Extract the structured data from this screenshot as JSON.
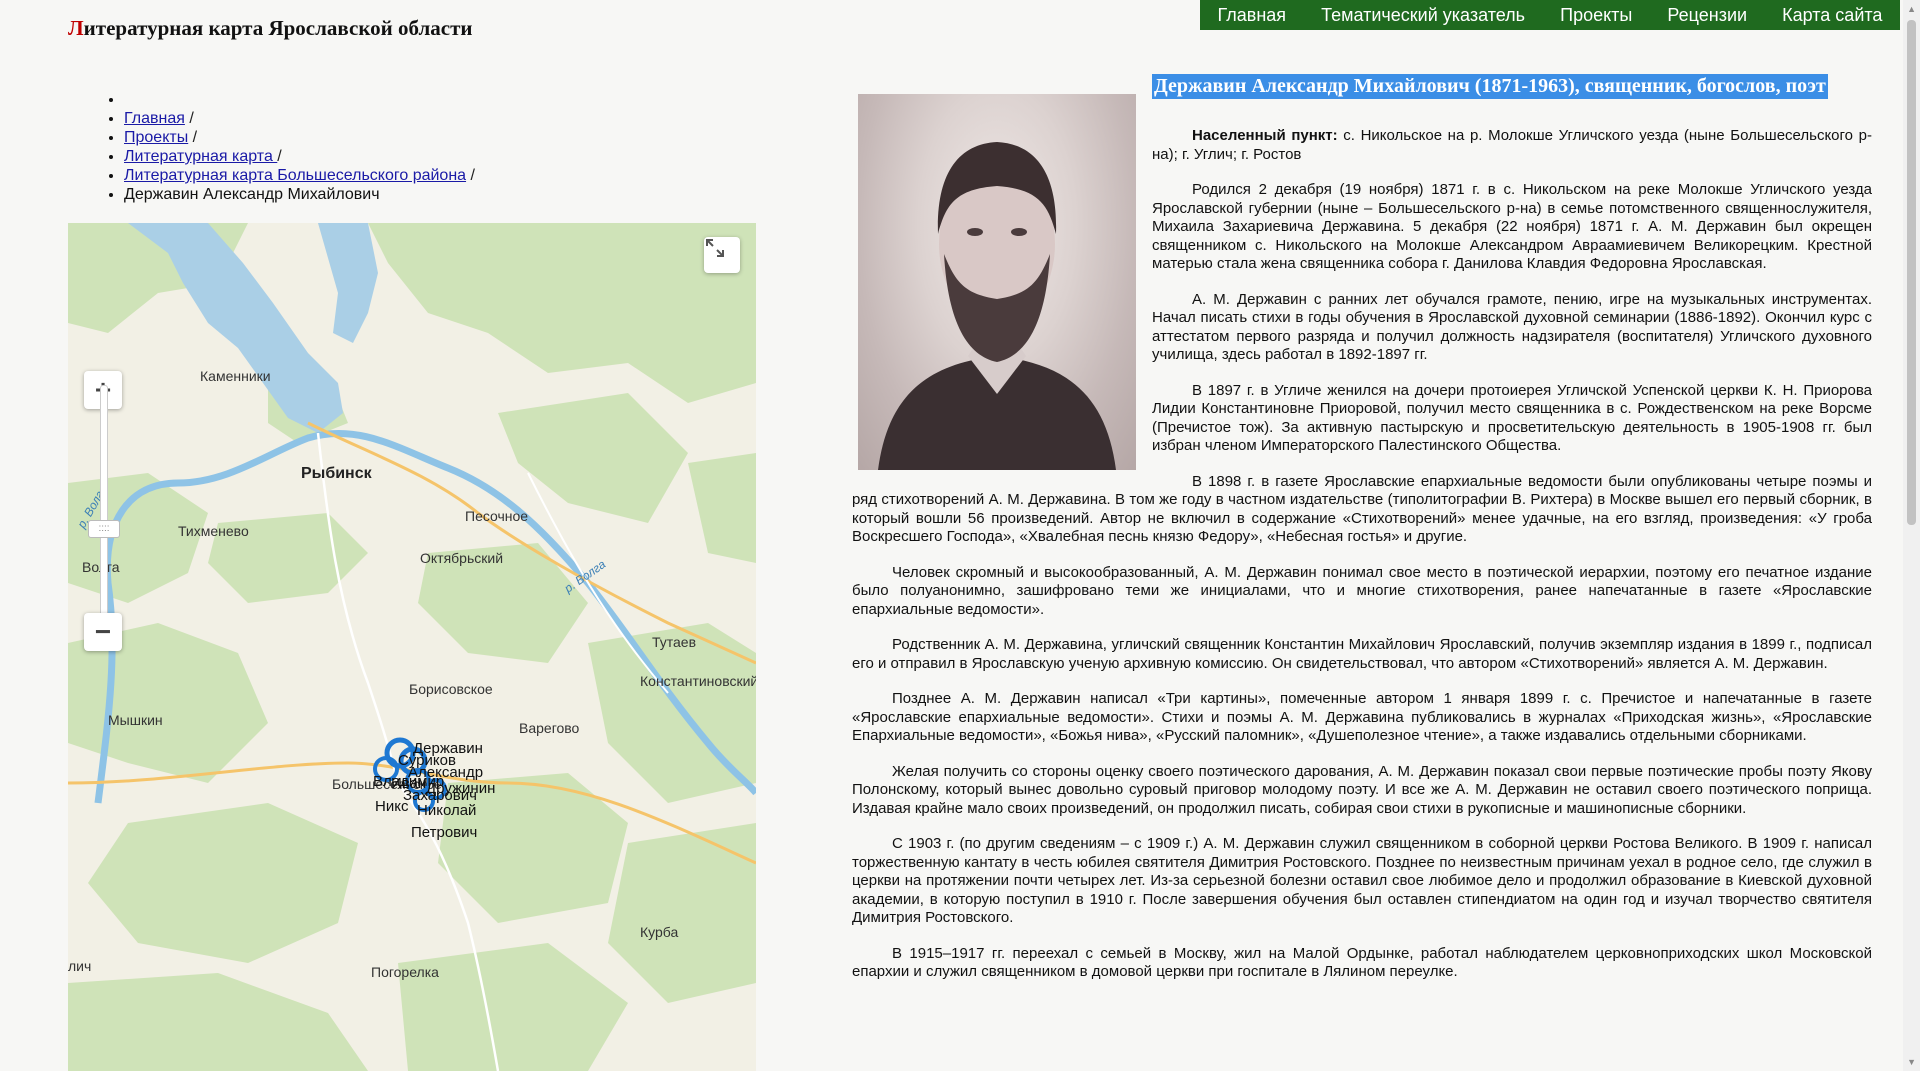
{
  "header": {
    "title_first_letter": "Л",
    "title_rest": "итературная карта Ярославской области"
  },
  "nav": [
    {
      "label": "Главная"
    },
    {
      "label": "Тематический указатель"
    },
    {
      "label": "Проекты"
    },
    {
      "label": "Рецензии"
    },
    {
      "label": "Карта сайта"
    }
  ],
  "breadcrumb": [
    {
      "label": "Главная",
      "link": true,
      "sep": " /"
    },
    {
      "label": "Проекты",
      "link": true,
      "sep": " /"
    },
    {
      "label": "Литературная карта ",
      "link": true,
      "sep": "/"
    },
    {
      "label": "Литературная карта Большесельского района",
      "link": true,
      "sep": " /"
    },
    {
      "label": "Державин Александр Михайлович",
      "link": false,
      "sep": ""
    }
  ],
  "map": {
    "places": [
      "Каменники",
      "Рыбинск",
      "Тихменево",
      "Песочное",
      "Октябрьский",
      "Волга",
      "Тутаев",
      "Константиновский",
      "Борисовское",
      "Мышкин",
      "Варегово",
      "Большесельское",
      "Курба",
      "Погорелка",
      "лич"
    ],
    "rivers": [
      "р. Волга",
      "р. Волга"
    ],
    "markers": [
      "Державин",
      "Суриков",
      "Александр",
      "Иван",
      "Захарович",
      "Николай",
      "Петрович",
      "Дружинин",
      "Владимир",
      "Никс"
    ],
    "zoom_in": "+",
    "zoom_out": "−",
    "zoom_handle": "::::"
  },
  "article": {
    "title": "Державин Александр Михайлович (1871-1963), священник, богослов, поэт",
    "place_label": "Населенный пункт:",
    "place_value": " с. Никольское на р. Молокше Угличского уезда (ныне Большесельского р-на); г. Углич; г. Ростов",
    "paragraphs": [
      "Родился 2 декабря (19 ноября) 1871 г. в с. Никольском на реке Молокше Угличского уезда Ярославской губернии (ныне – Большесельского р-на) в семье потомственного священнослужителя, Михаила Захариевича Державина. 5 декабря (22 ноября) 1871 г. А. М. Державин был окрещен священником с. Никольского на Молокше Александром Авраамиевичем Великорецким. Крестной матерью стала жена священника собора г. Данилова Клавдия Федоровна Ярославская.",
      "А. М. Державин с ранних лет обучался грамоте, пению, игре на музыкальных инструментах. Начал писать стихи в годы обучения в Ярославской духовной семинарии (1886-1892). Окончил курс с аттестатом первого разряда и получил должность надзирателя (воспитателя) Угличского духовного училища, здесь работал в 1892-1897 гг.",
      "В 1897 г. в Угличе женился на дочери протоиерея Угличской Успенской церкви К. Н. Приорова Лидии Константиновне Приоровой, получил место священника в с. Рождественском на реке Ворсме (Пречистое тож). За активную пастырскую и просветительскую деятельность в 1905-1908 гг. был избран членом Императорского Палестинского Общества.",
      "В 1898 г. в газете Ярославские епархиальные ведомости были опубликованы четыре поэмы и ряд стихотворений А. М. Державина. В том же году в частном издательстве (типолитографии В. Рихтера) в Москве вышел его первый сборник, в который вошли 56 произведений. Автор не включил в содержание «Стихотворений» менее удачные, на его взгляд, произведения: «У гроба Воскресшего Господа», «Хвалебная песнь князю Федору», «Небесная гостья» и другие.",
      "Человек скромный и высокообразованный, А. М. Державин понимал свое место в поэтической иерархии, поэтому его печатное издание было полуанонимно, зашифровано теми же инициалами, что и многие стихотворения, ранее напечатанные в газете «Ярославские епархиальные ведомости».",
      "Родственник А. М. Державина, угличский священник Константин Михайлович Ярославский, получив экземпляр издания в 1899 г., подписал его и отправил в Ярославскую ученую архивную комиссию. Он свидетельствовал, что автором «Стихотворений» является А. М. Державин.",
      "Позднее А. М. Державин написал «Три картины», помеченные автором 1 января 1899 г. с. Пречистое и напечатанные в газете «Ярославские епархиальные ведомости». Стихи и поэмы А. М. Державина публиковались в журналах «Приходская жизнь», «Ярославские Епархиальные ведомости», «Божья нива», «Русский паломник», «Душеполезное чтение», а также издавались отдельными сборниками.",
      "Желая получить со стороны оценку своего поэтического дарования, А. М. Державин показал свои первые поэтические пробы поэту Якову Полонскому, который вынес довольно суровый приговор молодому поэту. И все же А. М. Державин не оставил своего поэтического поприща. Издавая крайне мало своих произведений, он продолжил писать, собирая свои стихи в рукописные и машинописные сборники.",
      "С 1903 г. (по другим сведениям – с 1909 г.) А. М. Державин служил священником в соборной церкви Ростова Великого. В 1909 г. написал торжественную кантату в честь юбилея святителя Димитрия Ростовского. Позднее по неизвестным причинам уехал в родное село, где служил в церкви на протяжении почти четырех лет. Из-за серьезной болезни оставил свое любимое дело и продолжил образование в Киевской духовной академии, в которую поступил в 1910 г. После завершения обучения был оставлен стипендиатом на один год и изучал творчество святителя Димитрия Ростовского.",
      "В 1915–1917 гг. переехал с семьей в Москву, жил на Малой Ордынке, работал наблюдателем церковноприходских школ Московской епархии и служил священником в домовой церкви при госпитале в Лялином переулке."
    ]
  },
  "colors": {
    "nav_bg": "#1f6a1f",
    "title_highlight": "#3b8ee6",
    "title_first_letter": "#c00000",
    "link": "#1a1aa6"
  }
}
